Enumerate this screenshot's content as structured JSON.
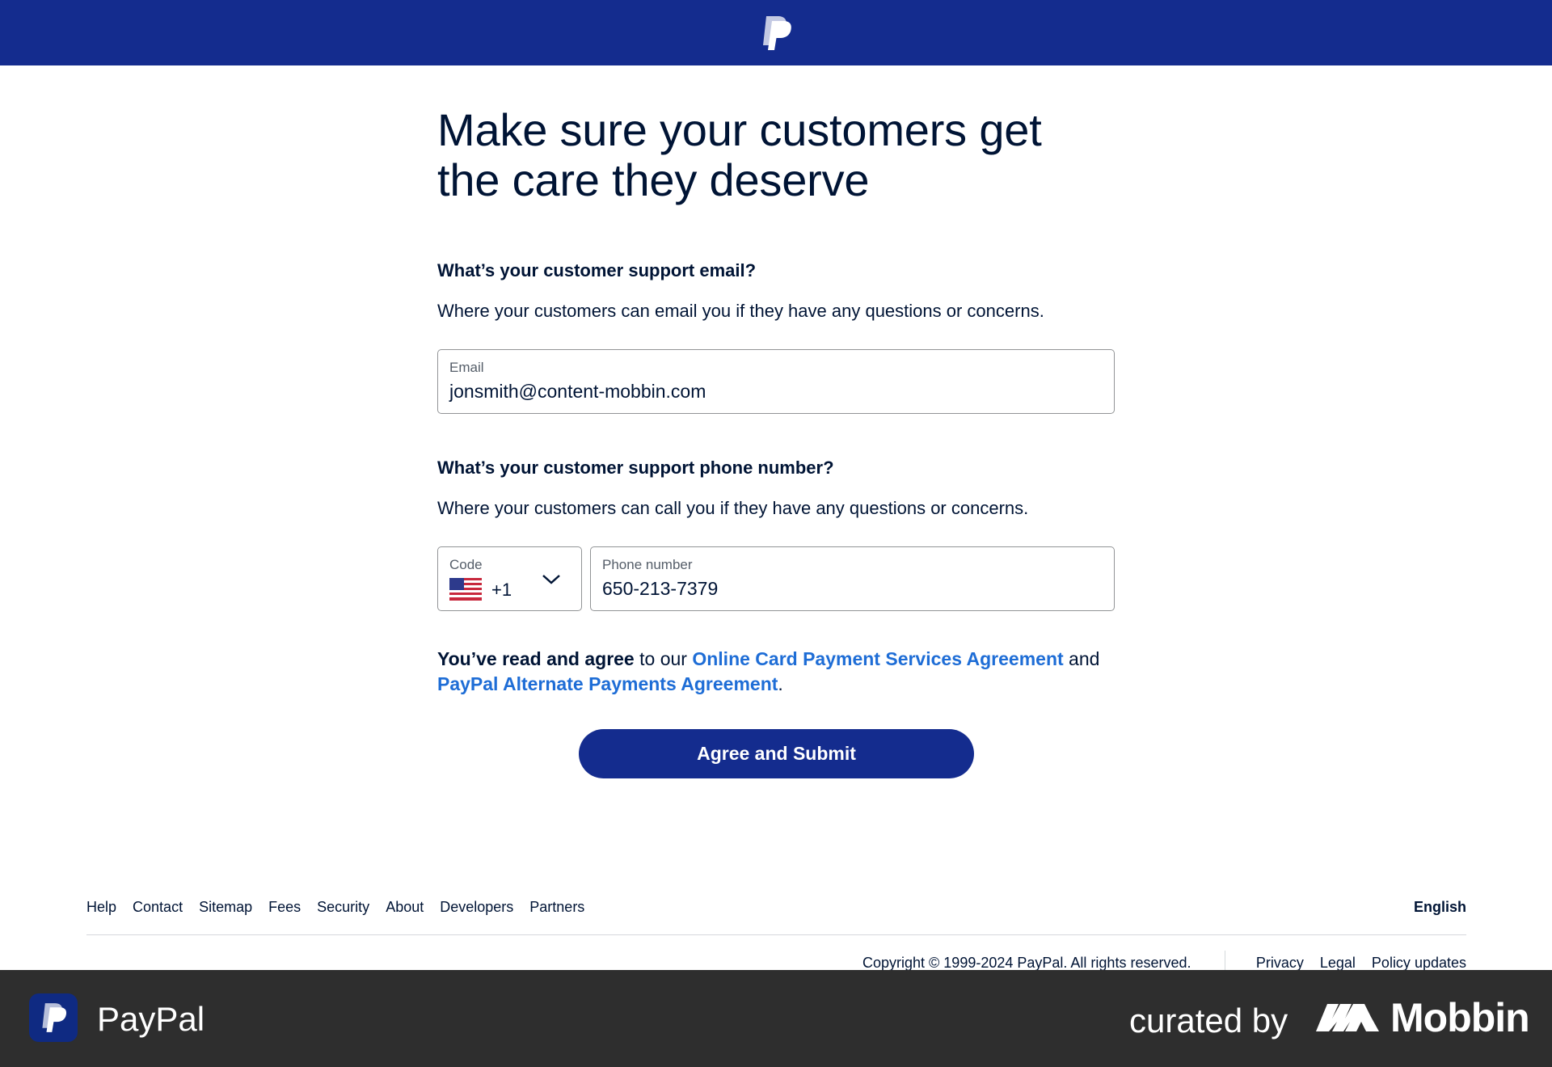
{
  "header": {
    "logo_icon": "paypal-p-icon",
    "bg_color": "#142c8e"
  },
  "main": {
    "headline": "Make sure your customers get the care they deserve",
    "email_section": {
      "title": "What’s your customer support email?",
      "description": "Where your customers can email you if they have any questions or concerns.",
      "field_label": "Email",
      "field_value": "jonsmith@content-mobbin.com"
    },
    "phone_section": {
      "title": "What’s your customer support phone number?",
      "description": "Where your customers can call you if they have any questions or concerns.",
      "code_label": "Code",
      "code_value": "+1",
      "code_flag_icon": "us-flag-icon",
      "phone_label": "Phone number",
      "phone_value": "650-213-7379"
    },
    "agreement": {
      "prefix_bold": "You’ve read and agree",
      "prefix": " to our ",
      "link1": "Online Card Payment Services Agreement",
      "middle": " and ",
      "link2": "PayPal Alternate Payments Agreement",
      "suffix": "."
    },
    "submit_label": "Agree and Submit",
    "link_color": "#1e6dd6",
    "primary_color": "#142c8e"
  },
  "footer": {
    "links": [
      "Help",
      "Contact",
      "Sitemap",
      "Fees",
      "Security",
      "About",
      "Developers",
      "Partners"
    ],
    "language": "English",
    "copyright": "Copyright © 1999-2024 PayPal. All rights reserved.",
    "legal_links": [
      "Privacy",
      "Legal",
      "Policy updates"
    ]
  },
  "watermark": {
    "app_name": "PayPal",
    "curated_by": "curated by",
    "brand": "Mobbin"
  }
}
